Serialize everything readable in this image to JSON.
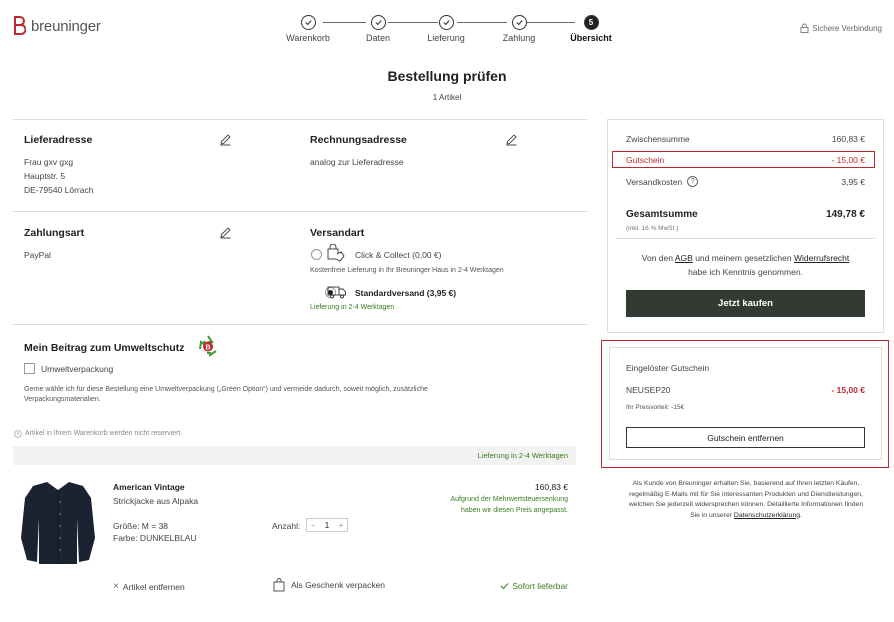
{
  "header": {
    "logo_text": "breuninger",
    "secure_label": "Sichere Verbindung",
    "steps": [
      {
        "label": "Warenkorb",
        "state": "done"
      },
      {
        "label": "Daten",
        "state": "done"
      },
      {
        "label": "Lieferung",
        "state": "done"
      },
      {
        "label": "Zahlung",
        "state": "done"
      },
      {
        "label": "Übersicht",
        "state": "active",
        "number": "5"
      }
    ]
  },
  "page": {
    "title": "Bestellung prüfen",
    "subtitle": "1 Artikel"
  },
  "delivery_address": {
    "title": "Lieferadresse",
    "lines": [
      "Frau gxv gxg",
      "Hauptstr. 5",
      "DE-79540 Lörrach"
    ]
  },
  "billing_address": {
    "title": "Rechnungsadresse",
    "text": "analog zur Lieferadresse"
  },
  "payment": {
    "title": "Zahlungsart",
    "method": "PayPal"
  },
  "shipping": {
    "title": "Versandart",
    "options": [
      {
        "label": "Click & Collect (0,00 €)",
        "note": "Kostenfreie Lieferung in Ihr Breuninger Haus in 2-4 Werktagen",
        "selected": false
      },
      {
        "label": "Standardversand (3,95 €)",
        "note": "Lieferung in 2-4 Werktagen",
        "selected": true
      }
    ]
  },
  "eco": {
    "title": "Mein Beitrag zum Umweltschutz",
    "checkbox_label": "Umweltverpackung",
    "description_line1": "Gerne wähle ich für diese Bestellung eine Umweltverpackung („Green Option“) und vermeide dadurch, soweit möglich, zusätzliche",
    "description_line2": "Verpackungsmaterialien."
  },
  "cart": {
    "reserve_note": "Artikel in Ihrem Warenkorb werden nicht reserviert.",
    "delivery_bar": "Lieferung in 2-4 Werktagen",
    "item": {
      "brand": "American Vintage",
      "name": "Strickjacke aus Alpaka",
      "size": "Größe: M = 38",
      "color": "Farbe: DUNKELBLAU",
      "qty_label": "Anzahl:",
      "qty": "1",
      "price": "160,83 €",
      "vat_note_line1": "Aufgrund der Mehrwertsteuersenkung",
      "vat_note_line2": "haben wir diesen Preis angepasst."
    },
    "remove_label": "Artikel entfernen",
    "gift_label": "Als Geschenk verpacken",
    "availability": "Sofort lieferbar"
  },
  "summary": {
    "subtotal_label": "Zwischensumme",
    "subtotal": "160,83 €",
    "voucher_label": "Gutschein",
    "voucher": "- 15,00 €",
    "shipping_label": "Versandkosten",
    "shipping": "3,95 €",
    "total_label": "Gesamtsumme",
    "total": "149,78 €",
    "vat_note": "(inkl. 16 % MwSt.)",
    "terms_pre": "Von den ",
    "terms_agb": "AGB",
    "terms_mid": " und meinem gesetzlichen ",
    "terms_withdrawal": "Widerrufsrecht",
    "terms_post": "habe ich Kenntnis genommen.",
    "buy_button": "Jetzt kaufen"
  },
  "voucher_box": {
    "title": "Eingelöster Gutschein",
    "code": "NEUSEP20",
    "amount": "- 15,00 €",
    "advantage": "Ihr Preisvorteil: -15€",
    "remove_button": "Gutschein entfernen"
  },
  "disclaimer": {
    "line1": "Als Kunde von Breuninger erhalten Sie, basierend auf Ihren letzten Käufen,",
    "line2": "regelmäßig E-Mails mit für Sie interessanten Produkten und Dienstleistungen,",
    "line3": "welchen Sie jederzeit widersprechen können. Detaillierte Informationen finden",
    "line4_pre": "Sie in unserer ",
    "line4_link": "Datenschutzerklärung",
    "line4_post": "."
  },
  "colors": {
    "accent_red": "#c0282f",
    "green": "#3a7d1f",
    "button_dark": "#333a33"
  }
}
